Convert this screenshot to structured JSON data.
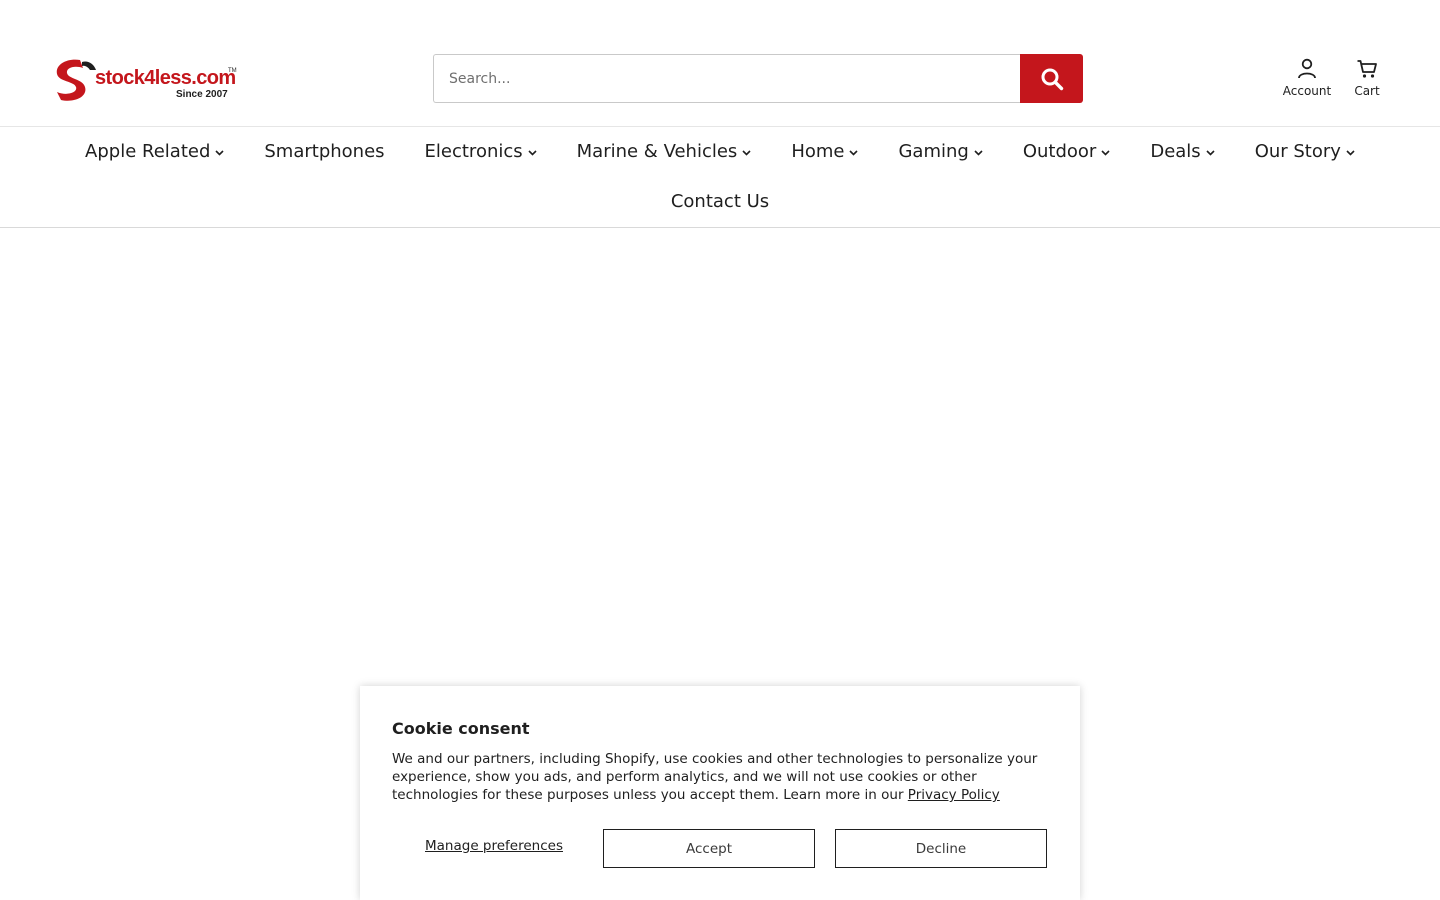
{
  "header": {
    "logo": {
      "brand": "stock4less.com",
      "tagline": "Since 2007",
      "trademark": "TM",
      "brand_color": "#c4161c"
    },
    "search": {
      "placeholder": "Search...",
      "value": "",
      "button_icon": "search-icon",
      "button_color": "#c4161c"
    },
    "account": {
      "label": "Account",
      "icon": "user-icon"
    },
    "cart": {
      "label": "Cart",
      "icon": "cart-icon"
    }
  },
  "nav": {
    "items": [
      {
        "label": "Apple Related",
        "has_dropdown": true
      },
      {
        "label": "Smartphones",
        "has_dropdown": false
      },
      {
        "label": "Electronics",
        "has_dropdown": true
      },
      {
        "label": "Marine & Vehicles",
        "has_dropdown": true
      },
      {
        "label": "Home",
        "has_dropdown": true
      },
      {
        "label": "Gaming",
        "has_dropdown": true
      },
      {
        "label": "Outdoor",
        "has_dropdown": true
      },
      {
        "label": "Deals",
        "has_dropdown": true
      },
      {
        "label": "Our Story",
        "has_dropdown": true
      },
      {
        "label": "Contact Us",
        "has_dropdown": false
      }
    ]
  },
  "cookie_banner": {
    "title": "Cookie consent",
    "text": "We and our partners, including Shopify, use cookies and other technologies to personalize your experience, show you ads, and perform analytics, and we will not use cookies or other technologies for these purposes unless you accept them. Learn more in our ",
    "privacy_link": "Privacy Policy",
    "manage_label": "Manage preferences",
    "accept_label": "Accept",
    "decline_label": "Decline"
  }
}
